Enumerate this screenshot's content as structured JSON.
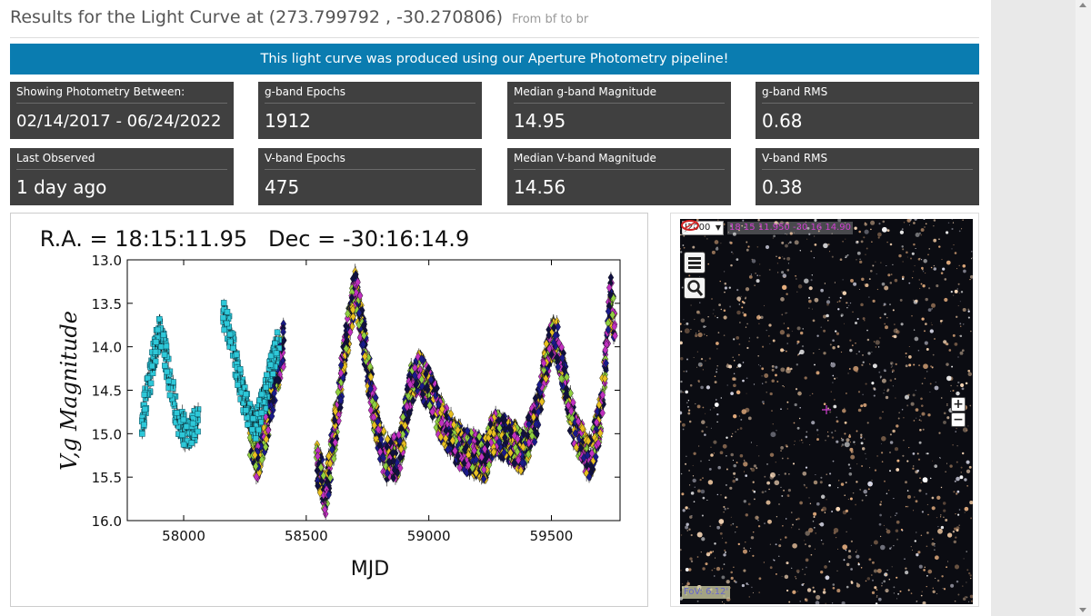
{
  "header": {
    "title": "Results for the Light Curve at (273.799792 , -30.270806)",
    "subtitle": "From bf to br"
  },
  "banner": {
    "text": "This light curve was produced using our Aperture Photometry pipeline!"
  },
  "stats": [
    {
      "label": "Showing Photometry Between:",
      "value": "02/14/2017 - 06/24/2022"
    },
    {
      "label": "g-band Epochs",
      "value": "1912"
    },
    {
      "label": "Median g-band Magnitude",
      "value": "14.95"
    },
    {
      "label": "g-band RMS",
      "value": "0.68"
    },
    {
      "label": "Last Observed",
      "value": "1 day ago"
    },
    {
      "label": "V-band Epochs",
      "value": "475"
    },
    {
      "label": "Median V-band Magnitude",
      "value": "14.56"
    },
    {
      "label": "V-band RMS",
      "value": "0.38"
    }
  ],
  "chart_data": {
    "type": "scatter",
    "title": "R.A. = 18:15:11.95   Dec = -30:16:14.9",
    "xlabel": "MJD",
    "ylabel": "V,g Magnitude",
    "xlim": [
      57770,
      59780
    ],
    "ylim": [
      16.0,
      13.0
    ],
    "y_inverted": true,
    "xticks": [
      58000,
      58500,
      59000,
      59500
    ],
    "xtick_labels": [
      "58000",
      "58500",
      "59000",
      "59500"
    ],
    "yticks": [
      13.0,
      13.5,
      14.0,
      14.5,
      15.0,
      15.5,
      16.0
    ],
    "ytick_labels": [
      "13.0",
      "13.5",
      "14.0",
      "14.5",
      "15.0",
      "15.5",
      "16.0"
    ],
    "grid": false,
    "colors": {
      "v_band": "#2ec8d8",
      "g_band": [
        "#1a1a8a",
        "#c030c0",
        "#e8c020",
        "#90d040",
        "#101040"
      ]
    },
    "v_band_curve": [
      [
        57830,
        14.85
      ],
      [
        57860,
        14.4
      ],
      [
        57880,
        14.05
      ],
      [
        57900,
        13.85
      ],
      [
        57920,
        14.0
      ],
      [
        57940,
        14.35
      ],
      [
        57960,
        14.6
      ],
      [
        57980,
        14.85
      ],
      [
        58000,
        14.95
      ],
      [
        58030,
        15.0
      ],
      [
        58060,
        14.8
      ],
      [
        58160,
        13.6
      ],
      [
        58190,
        13.85
      ],
      [
        58220,
        14.3
      ],
      [
        58250,
        14.65
      ],
      [
        58290,
        14.95
      ],
      [
        58330,
        14.6
      ],
      [
        58360,
        14.2
      ],
      [
        58390,
        13.9
      ]
    ],
    "g_band_curve": [
      [
        58270,
        15.0
      ],
      [
        58300,
        15.3
      ],
      [
        58330,
        15.0
      ],
      [
        58380,
        14.3
      ],
      [
        58410,
        13.95
      ],
      [
        58540,
        15.3
      ],
      [
        58580,
        15.7
      ],
      [
        58620,
        14.9
      ],
      [
        58660,
        14.0
      ],
      [
        58700,
        13.3
      ],
      [
        58730,
        13.85
      ],
      [
        58770,
        14.6
      ],
      [
        58800,
        15.1
      ],
      [
        58830,
        15.3
      ],
      [
        58880,
        15.25
      ],
      [
        58930,
        14.4
      ],
      [
        58960,
        14.3
      ],
      [
        59010,
        14.55
      ],
      [
        59050,
        14.85
      ],
      [
        59100,
        15.05
      ],
      [
        59140,
        15.2
      ],
      [
        59170,
        15.2
      ],
      [
        59230,
        15.3
      ],
      [
        59260,
        15.0
      ],
      [
        59320,
        15.05
      ],
      [
        59380,
        15.2
      ],
      [
        59430,
        14.9
      ],
      [
        59460,
        14.5
      ],
      [
        59490,
        14.0
      ],
      [
        59520,
        13.9
      ],
      [
        59550,
        14.3
      ],
      [
        59580,
        14.8
      ],
      [
        59620,
        15.1
      ],
      [
        59660,
        15.3
      ],
      [
        59700,
        14.8
      ],
      [
        59720,
        14.2
      ],
      [
        59740,
        13.4
      ],
      [
        59760,
        13.8
      ]
    ]
  },
  "sky_viewer": {
    "frame": "J2000",
    "coords": "18 15 11.950 -30 16 14.90",
    "fov": "FoV: 6.12'",
    "zoom_in": "+",
    "zoom_out": "−"
  }
}
